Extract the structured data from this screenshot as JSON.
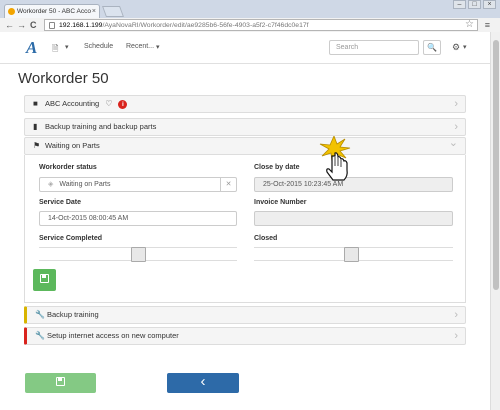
{
  "browser": {
    "tab_title": "Workorder 50 - ABC Acco",
    "tab_close": "×",
    "window_buttons": [
      "–",
      "□",
      "×"
    ],
    "url_host": "192.168.1.199",
    "url_path": "/AyaNovaRI/Workorder/edit/ae9285b6-56fe-4903-a5f2-c7f46dc0e17f",
    "back": "←",
    "forward": "→",
    "reload": "C",
    "star": "☆",
    "menu": "≡"
  },
  "appnav": {
    "logo": "A",
    "new_icon": "🗎",
    "new_caret": "▾",
    "schedule": "Schedule",
    "recent": "Recent...",
    "recent_caret": "▾",
    "search_placeholder": "Search",
    "search_icon": "🔍",
    "settings_icon": "⚙",
    "settings_caret": "▾"
  },
  "page": {
    "title": "Workorder 50"
  },
  "panels": {
    "client": {
      "label": "ABC Accounting",
      "icon": "building-icon",
      "alert": "i",
      "chev": "›"
    },
    "summary": {
      "label": "Backup training and backup parts",
      "chev": "›"
    },
    "status": {
      "label": "Waiting on Parts",
      "chev": "⌄"
    },
    "item1": {
      "label": "Backup training",
      "chev": "›"
    },
    "item2": {
      "label": "Setup internet access on new computer",
      "chev": "›"
    }
  },
  "form": {
    "workorder_status_label": "Workorder status",
    "workorder_status_value": "Waiting on Parts",
    "clear": "✕",
    "close_by_label": "Close by date",
    "close_by_value": "25-Oct-2015  10:23:45 AM",
    "service_date_label": "Service Date",
    "service_date_value": "14-Oct-2015  08:00:45 AM",
    "invoice_label": "Invoice Number",
    "invoice_value": "",
    "service_completed_label": "Service Completed",
    "closed_label": "Closed"
  },
  "footer": {
    "back_icon": "‹"
  },
  "colors": {
    "accent": "#2d6aa8",
    "save_green": "#5cb85c",
    "alert_red": "#d9231d",
    "warning_yellow": "#d8b400"
  }
}
